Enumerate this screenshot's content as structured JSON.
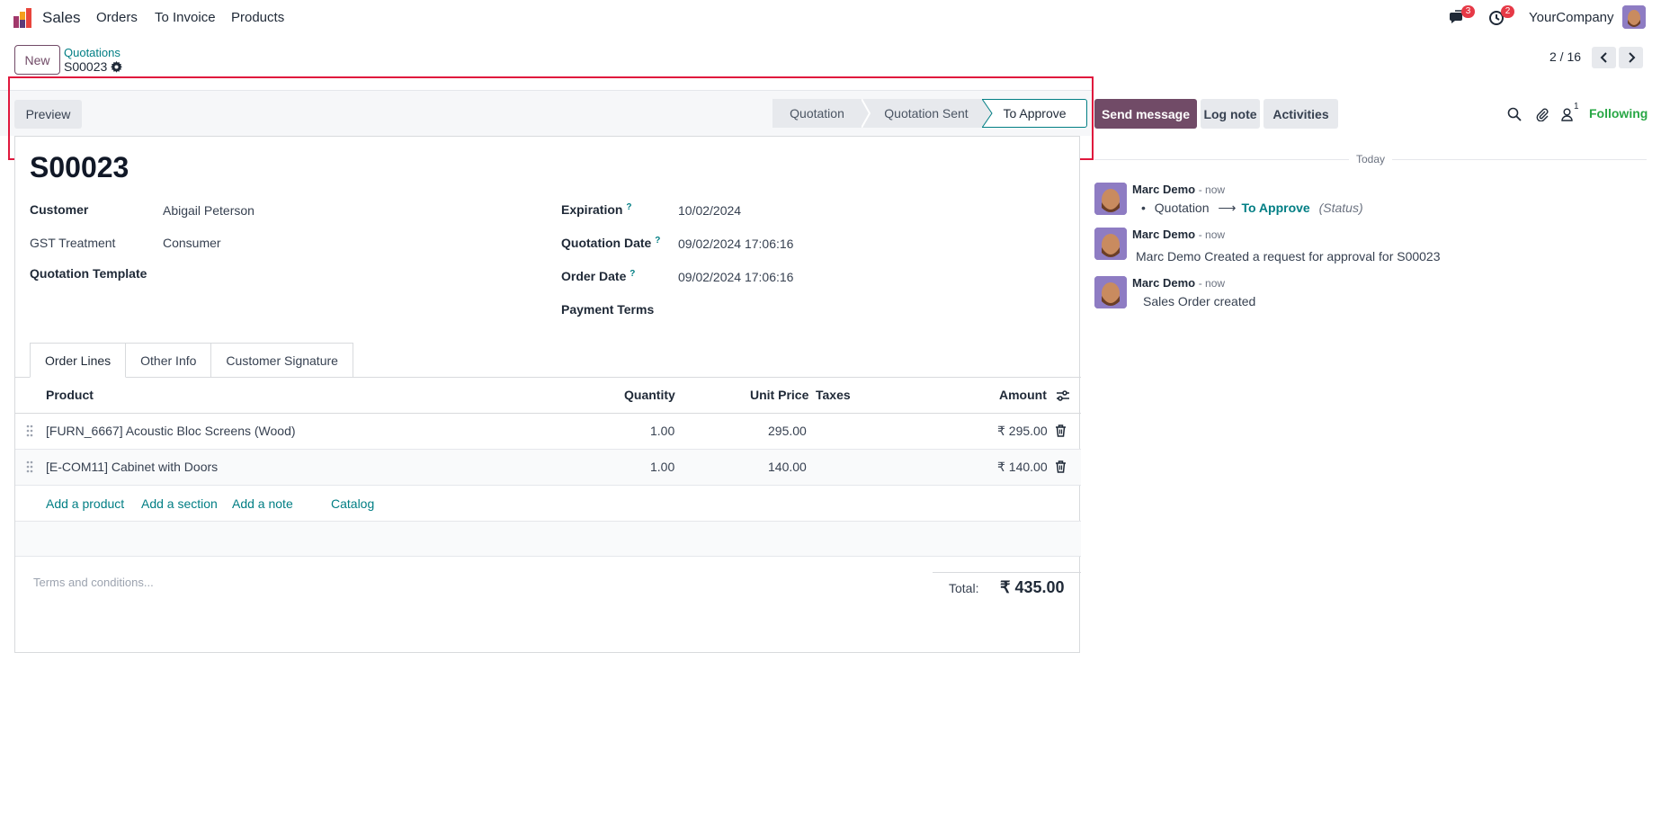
{
  "topbar": {
    "app_name": "Sales",
    "menu": [
      "Orders",
      "To Invoice",
      "Products"
    ],
    "messages_count": "3",
    "activities_count": "2",
    "company": "YourCompany"
  },
  "control": {
    "new_label": "New",
    "breadcrumb_parent": "Quotations",
    "breadcrumb_current": "S00023",
    "pager": "2 / 16"
  },
  "statusbar": {
    "preview_label": "Preview",
    "stages": [
      "Quotation",
      "Quotation Sent",
      "To Approve"
    ],
    "active_stage": "To Approve"
  },
  "form": {
    "order_name": "S00023",
    "customer_label": "Customer",
    "customer_value": "Abigail Peterson",
    "gst_label": "GST Treatment",
    "gst_value": "Consumer",
    "template_label": "Quotation Template",
    "expiration_label": "Expiration",
    "expiration_value": "10/02/2024",
    "quotation_date_label": "Quotation Date",
    "quotation_date_value": "09/02/2024 17:06:16",
    "order_date_label": "Order Date",
    "order_date_value": "09/02/2024 17:06:16",
    "payment_terms_label": "Payment Terms",
    "help_mark": "?"
  },
  "tabs": [
    "Order Lines",
    "Other Info",
    "Customer Signature"
  ],
  "table": {
    "headers": {
      "product": "Product",
      "quantity": "Quantity",
      "unit_price": "Unit Price",
      "taxes": "Taxes",
      "amount": "Amount"
    },
    "rows": [
      {
        "product": "[FURN_6667] Acoustic Bloc Screens (Wood)",
        "quantity": "1.00",
        "unit_price": "295.00",
        "taxes": "",
        "amount": "₹ 295.00"
      },
      {
        "product": "[E-COM11] Cabinet with Doors",
        "quantity": "1.00",
        "unit_price": "140.00",
        "taxes": "",
        "amount": "₹ 140.00"
      }
    ],
    "add_links": [
      "Add a product",
      "Add a section",
      "Add a note",
      "Catalog"
    ]
  },
  "footer": {
    "terms_placeholder": "Terms and conditions...",
    "total_label": "Total:",
    "total_value": "₹ 435.00"
  },
  "chatter": {
    "send_message": "Send message",
    "log_note": "Log note",
    "activities": "Activities",
    "followers_count": "1",
    "following": "Following",
    "date_separator": "Today",
    "messages": [
      {
        "author": "Marc Demo",
        "time": "- now",
        "old": "Quotation",
        "new": "To Approve",
        "field": "(Status)"
      },
      {
        "author": "Marc Demo",
        "time": "- now",
        "body": "Marc Demo Created a request for approval for S00023"
      },
      {
        "author": "Marc Demo",
        "time": "- now",
        "body": "Sales Order created"
      }
    ]
  },
  "colors": {
    "brand": "#714b67",
    "link": "#017e84",
    "badge": "#e63946",
    "following": "#28a745",
    "highlight": "#e0183d"
  }
}
